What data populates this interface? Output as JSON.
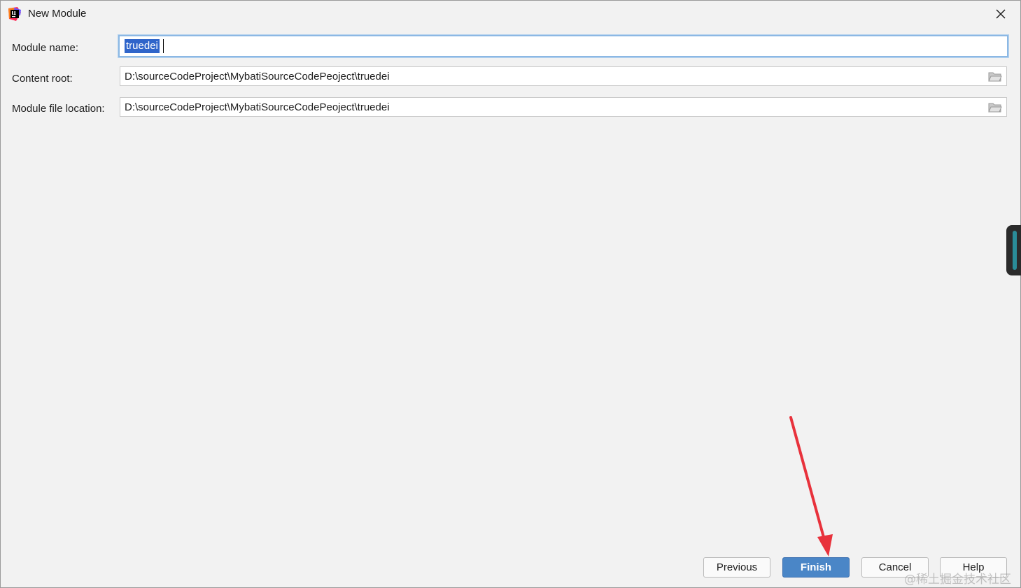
{
  "window": {
    "title": "New Module",
    "app_icon": "intellij-idea-icon",
    "close_icon": "close-icon"
  },
  "form": {
    "module_name": {
      "label": "Module name:",
      "value": "truedei"
    },
    "content_root": {
      "label": "Content root:",
      "value": "D:\\sourceCodeProject\\MybatiSourceCodePeoject\\truedei",
      "icon": "folder-icon"
    },
    "module_file_location": {
      "label": "Module file location:",
      "value": "D:\\sourceCodeProject\\MybatiSourceCodePeoject\\truedei",
      "icon": "folder-icon"
    }
  },
  "buttons": {
    "previous": "Previous",
    "finish": "Finish",
    "cancel": "Cancel",
    "help": "Help"
  },
  "annotation": {
    "arrow_color": "#e8323c",
    "target": "finish-button"
  },
  "watermark": "@稀土掘金技术社区",
  "colors": {
    "primary_button": "#4a86c7",
    "selection": "#2f65ca",
    "focus_border": "#8cb8e4"
  }
}
